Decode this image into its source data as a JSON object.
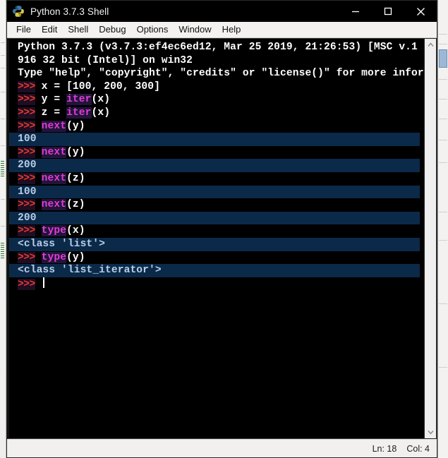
{
  "window": {
    "title": "Python 3.7.3 Shell",
    "icon": "python-logo-icon",
    "controls": {
      "minimize": "minimize-icon",
      "maximize": "maximize-icon",
      "close": "close-icon"
    }
  },
  "menubar": {
    "items": [
      {
        "label": "File"
      },
      {
        "label": "Edit"
      },
      {
        "label": "Shell"
      },
      {
        "label": "Debug"
      },
      {
        "label": "Options"
      },
      {
        "label": "Window"
      },
      {
        "label": "Help"
      }
    ]
  },
  "shell": {
    "banner": [
      "Python 3.7.3 (v3.7.3:ef4ec6ed12, Mar 25 2019, 21:26:53) [MSC v.1",
      "916 32 bit (Intel)] on win32",
      "Type \"help\", \"copyright\", \"credits\" or \"license()\" for more information."
    ],
    "lines": [
      {
        "kind": "input",
        "prompt": ">>>",
        "segments": [
          {
            "t": " x = [100, 200, 300]",
            "style": "plain"
          }
        ]
      },
      {
        "kind": "input",
        "prompt": ">>>",
        "segments": [
          {
            "t": " y = ",
            "style": "plain"
          },
          {
            "t": "iter",
            "style": "builtin"
          },
          {
            "t": "(x)",
            "style": "plain"
          }
        ]
      },
      {
        "kind": "input",
        "prompt": ">>>",
        "segments": [
          {
            "t": " z = ",
            "style": "plain"
          },
          {
            "t": "iter",
            "style": "builtin"
          },
          {
            "t": "(x)",
            "style": "plain"
          }
        ]
      },
      {
        "kind": "input",
        "prompt": ">>>",
        "segments": [
          {
            "t": " ",
            "style": "plain"
          },
          {
            "t": "next",
            "style": "builtin"
          },
          {
            "t": "(y)",
            "style": "plain"
          }
        ]
      },
      {
        "kind": "output",
        "text": "100"
      },
      {
        "kind": "input",
        "prompt": ">>>",
        "segments": [
          {
            "t": " ",
            "style": "plain"
          },
          {
            "t": "next",
            "style": "builtin"
          },
          {
            "t": "(y)",
            "style": "plain"
          }
        ]
      },
      {
        "kind": "output",
        "text": "200"
      },
      {
        "kind": "input",
        "prompt": ">>>",
        "segments": [
          {
            "t": " ",
            "style": "plain"
          },
          {
            "t": "next",
            "style": "builtin"
          },
          {
            "t": "(z)",
            "style": "plain"
          }
        ]
      },
      {
        "kind": "output",
        "text": "100"
      },
      {
        "kind": "input",
        "prompt": ">>>",
        "segments": [
          {
            "t": " ",
            "style": "plain"
          },
          {
            "t": "next",
            "style": "builtin"
          },
          {
            "t": "(z)",
            "style": "plain"
          }
        ]
      },
      {
        "kind": "output",
        "text": "200"
      },
      {
        "kind": "input",
        "prompt": ">>>",
        "segments": [
          {
            "t": " ",
            "style": "plain"
          },
          {
            "t": "type",
            "style": "builtin"
          },
          {
            "t": "(x)",
            "style": "plain"
          }
        ]
      },
      {
        "kind": "output",
        "text": "<class 'list'>"
      },
      {
        "kind": "input",
        "prompt": ">>>",
        "segments": [
          {
            "t": " ",
            "style": "plain"
          },
          {
            "t": "type",
            "style": "builtin"
          },
          {
            "t": "(y)",
            "style": "plain"
          }
        ]
      },
      {
        "kind": "output",
        "text": "<class 'list_iterator'>"
      },
      {
        "kind": "cursor",
        "prompt": ">>>",
        "segments": [
          {
            "t": " ",
            "style": "plain"
          }
        ]
      }
    ]
  },
  "scrollbar": {
    "up_icon": "chevron-up-icon",
    "down_icon": "chevron-down-icon"
  },
  "statusbar": {
    "line": "Ln: 18",
    "col": "Col: 4"
  },
  "colors": {
    "prompt": "#e8392a",
    "builtin": "#e23bd6",
    "output_text": "#b8cfe8",
    "output_bg": "#0b2a4a",
    "code_bg": "#000000",
    "titlebar_bg": "#000000",
    "chrome_bg": "#f1f0ef"
  }
}
